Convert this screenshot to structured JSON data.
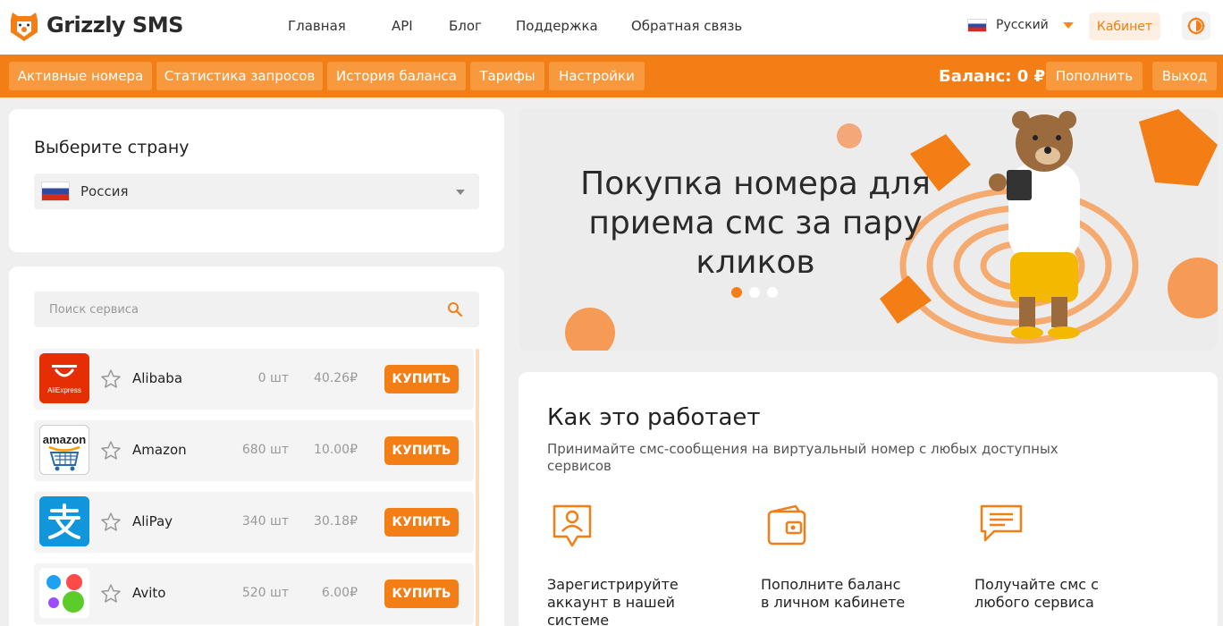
{
  "brand": {
    "name": "Grizzly SMS",
    "accent": "#f47e16",
    "logo_icon": "bear-head-icon"
  },
  "nav": {
    "items": [
      "Главная",
      "API",
      "Блог",
      "Поддержка",
      "Обратная связь"
    ]
  },
  "language": {
    "label": "Русский",
    "icon": "russia-flag-icon"
  },
  "header": {
    "cabinet_label": "Кабинет",
    "theme_icon": "theme-toggle-icon"
  },
  "menu": {
    "tabs": [
      "Активные номера",
      "Статистика запросов",
      "История баланса",
      "Тарифы",
      "Настройки"
    ],
    "balance": "Баланс: 0 ₽",
    "topup_label": "Пополнить",
    "logout_label": "Выход"
  },
  "country": {
    "heading": "Выберите страну",
    "selected": "Россия"
  },
  "search": {
    "placeholder": "Поиск сервиса",
    "icon": "search-icon"
  },
  "services": [
    {
      "name": "Alibaba",
      "qty": "0 шт",
      "price": "40.26₽",
      "buy_label": "КУПИТЬ",
      "icon": "aliexpress-logo"
    },
    {
      "name": "Amazon",
      "qty": "680 шт",
      "price": "10.00₽",
      "buy_label": "КУПИТЬ",
      "icon": "amazon-logo"
    },
    {
      "name": "AliPay",
      "qty": "340 шт",
      "price": "30.18₽",
      "buy_label": "КУПИТЬ",
      "icon": "alipay-logo"
    },
    {
      "name": "Avito",
      "qty": "520 шт",
      "price": "6.00₽",
      "buy_label": "КУПИТЬ",
      "icon": "avito-logo"
    }
  ],
  "banner": {
    "title": "Покупка номера для приема смс за пару кликов",
    "slides": 3,
    "active_slide": 1
  },
  "how": {
    "title": "Как это работает",
    "subtitle": "Принимайте смс-сообщения на виртуальный номер с любых доступных сервисов",
    "steps": [
      {
        "text": "Зарегистрируйте аккаунт в нашей системе",
        "icon": "user-card-icon"
      },
      {
        "text": "Пополните баланс в личном кабинете",
        "icon": "wallet-icon"
      },
      {
        "text": "Получайте смс с любого сервиса",
        "icon": "message-icon"
      }
    ]
  }
}
